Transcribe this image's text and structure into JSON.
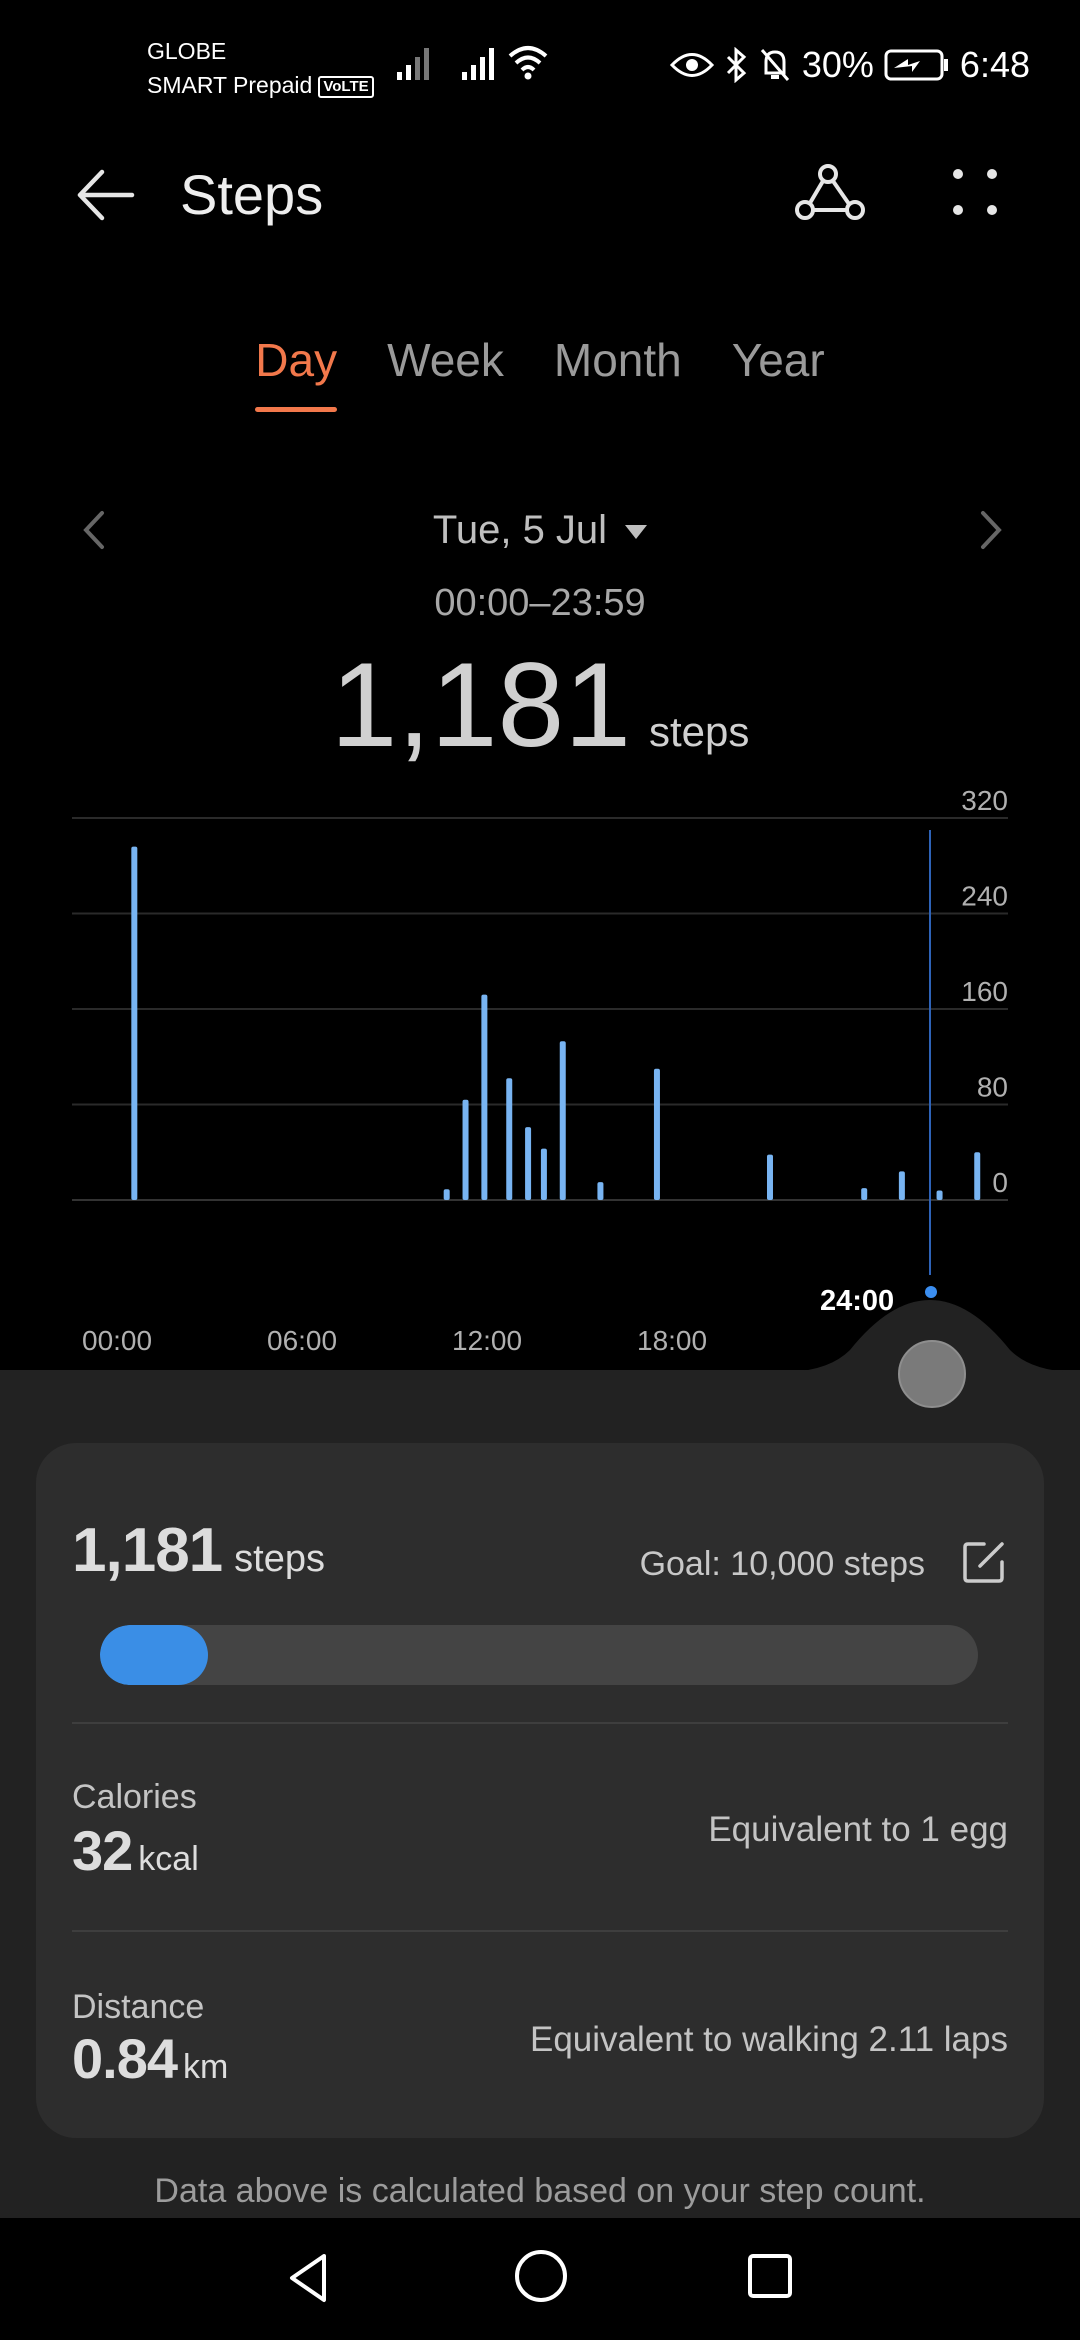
{
  "status_bar": {
    "carrier_line1": "GLOBE",
    "carrier_line2": "SMART Prepaid",
    "volte": "VoLTE",
    "battery": "30%",
    "time": "6:48",
    "icons": [
      "signal-icon",
      "wifi-icon",
      "eye-icon",
      "bluetooth-icon",
      "bell-off-icon",
      "battery-charging-icon"
    ]
  },
  "header": {
    "title": "Steps",
    "back_icon": "arrow-left-icon",
    "route_icon": "route-icon",
    "more_icon": "more-dots-icon"
  },
  "tabs": [
    {
      "label": "Day",
      "active": true
    },
    {
      "label": "Week",
      "active": false
    },
    {
      "label": "Month",
      "active": false
    },
    {
      "label": "Year",
      "active": false
    }
  ],
  "date_nav": {
    "date": "Tue, 5 Jul",
    "range": "00:00–23:59",
    "total": "1,181",
    "unit": "steps"
  },
  "chart_data": {
    "type": "bar",
    "y_ticks": [
      "320",
      "240",
      "160",
      "80",
      "0"
    ],
    "ylim": [
      0,
      320
    ],
    "x_labels": [
      "00:00",
      "06:00",
      "12:00",
      "18:00"
    ],
    "end_label": "24:00",
    "xlim_hours": [
      0,
      24
    ],
    "bars": [
      {
        "hour": 0.38,
        "value": 296
      },
      {
        "hour": 8.67,
        "value": 9
      },
      {
        "hour": 9.17,
        "value": 84
      },
      {
        "hour": 9.67,
        "value": 172
      },
      {
        "hour": 10.33,
        "value": 102
      },
      {
        "hour": 10.83,
        "value": 61
      },
      {
        "hour": 11.25,
        "value": 43
      },
      {
        "hour": 11.75,
        "value": 133
      },
      {
        "hour": 12.75,
        "value": 15
      },
      {
        "hour": 14.25,
        "value": 110
      },
      {
        "hour": 17.25,
        "value": 38
      },
      {
        "hour": 19.75,
        "value": 10
      },
      {
        "hour": 20.75,
        "value": 24
      },
      {
        "hour": 21.75,
        "value": 8
      },
      {
        "hour": 22.75,
        "value": 40
      }
    ],
    "bar_color": "#78b4f2",
    "grid_color": "#2a2a2a",
    "cursor_color": "#2e63b8"
  },
  "summary": {
    "steps_value": "1,181",
    "steps_unit": "steps",
    "goal": "Goal: 10,000 steps",
    "progress_fraction": 0.1181,
    "progress_color": "#3a8ee6",
    "calories_label": "Calories",
    "calories_value": "32",
    "calories_unit": "kcal",
    "calories_equiv": "Equivalent to 1 egg",
    "distance_label": "Distance",
    "distance_value": "0.84",
    "distance_unit": "km",
    "distance_equiv": "Equivalent to walking 2.11 laps",
    "footnote": "Data above is calculated based on your step count."
  },
  "colors": {
    "accent": "#f2784b",
    "bar": "#78b4f2",
    "panel": "#222222",
    "card": "#2d2d2d"
  }
}
